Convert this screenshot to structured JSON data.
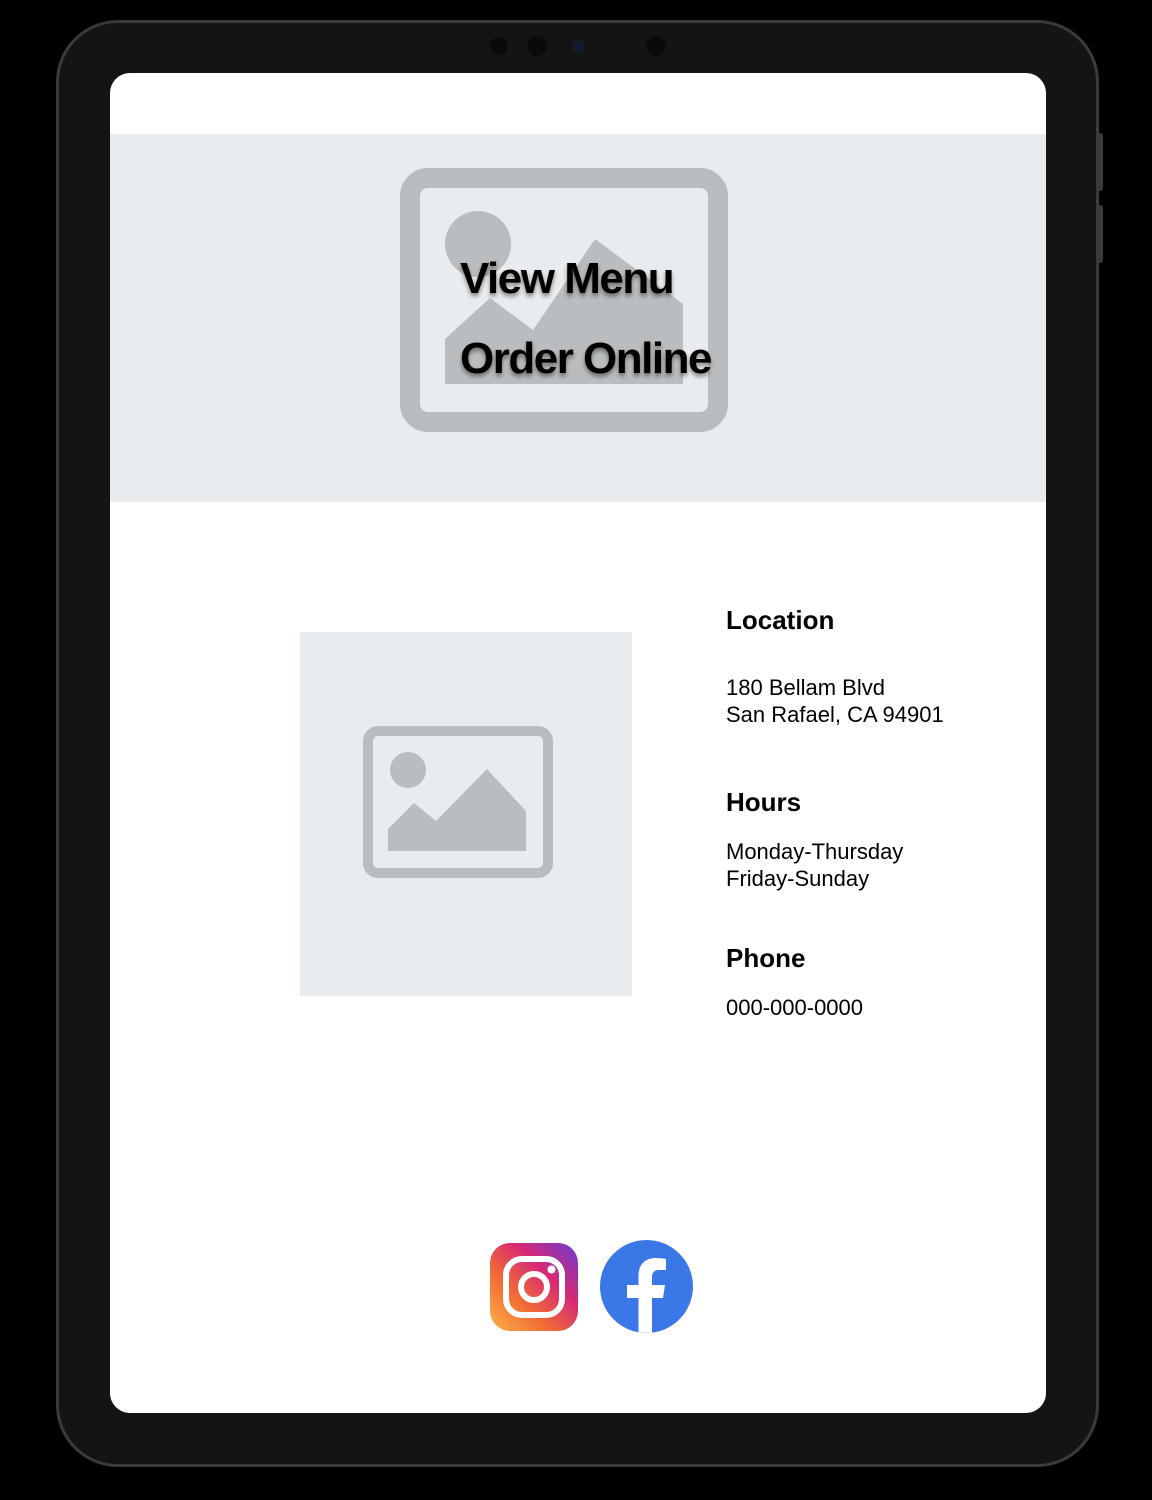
{
  "hero": {
    "view_menu_label": "View Menu",
    "order_online_label": "Order Online"
  },
  "info": {
    "location": {
      "heading": "Location",
      "address_line1": "180 Bellam Blvd",
      "address_line2": "San Rafael, CA 94901"
    },
    "hours": {
      "heading": "Hours",
      "line1": "Monday-Thursday",
      "line2": "Friday-Sunday"
    },
    "phone": {
      "heading": "Phone",
      "number": "000-000-0000"
    }
  },
  "social": {
    "icons": [
      "instagram-icon",
      "facebook-icon"
    ]
  },
  "colors": {
    "placeholder_bg": "#e9ecef",
    "placeholder_icon": "#babdbf",
    "facebook_blue": "#3b78e7",
    "device_frame": "#141414"
  }
}
